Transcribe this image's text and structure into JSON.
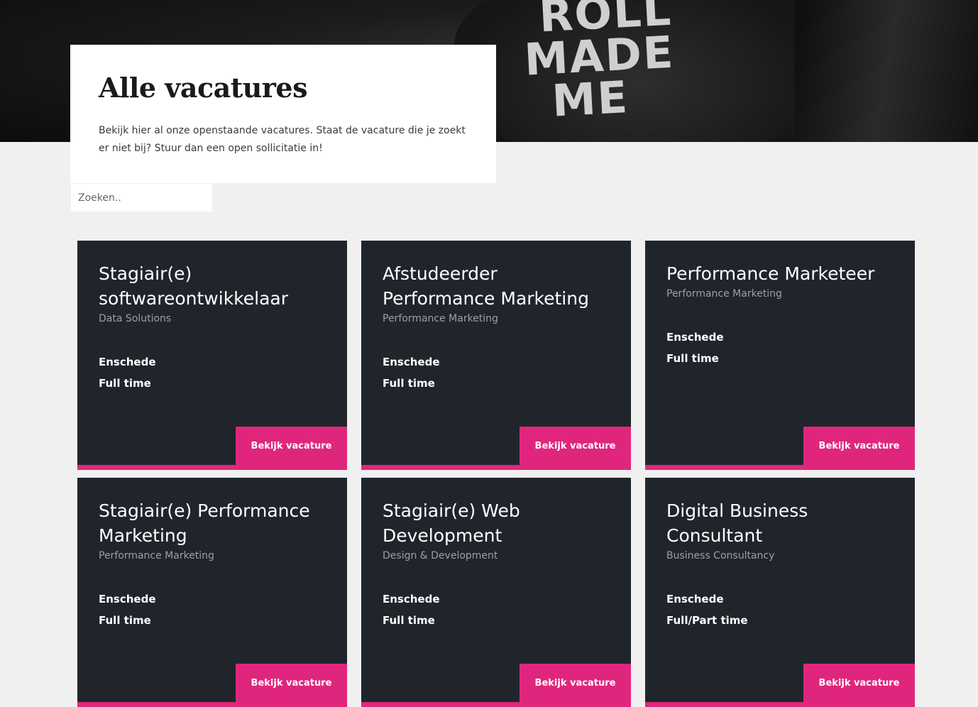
{
  "hero": {
    "shirt_lines": [
      "ROLL",
      "MADE",
      "ME"
    ]
  },
  "intro": {
    "title": "Alle vacatures",
    "description": "Bekijk hier al onze openstaande vacatures. Staat de vacature die je zoekt er niet bij? Stuur dan een open sollicitatie in!"
  },
  "search": {
    "placeholder": "Zoeken.."
  },
  "colors": {
    "card_bg": "#20252c",
    "accent": "#e0267c",
    "page_bg": "#f0f0f0"
  },
  "jobs": [
    {
      "title": "Stagiair(e) softwareontwikkelaar",
      "department": "Data Solutions",
      "location": "Enschede",
      "type": "Full time",
      "button": "Bekijk vacature"
    },
    {
      "title": "Afstudeerder Performance Marketing",
      "department": "Performance Marketing",
      "location": "Enschede",
      "type": "Full time",
      "button": "Bekijk vacature"
    },
    {
      "title": "Performance Marketeer",
      "department": "Performance Marketing",
      "location": "Enschede",
      "type": "Full time",
      "button": "Bekijk vacature"
    },
    {
      "title": "Stagiair(e) Performance Marketing",
      "department": "Performance Marketing",
      "location": "Enschede",
      "type": "Full time",
      "button": "Bekijk vacature"
    },
    {
      "title": "Stagiair(e) Web Development",
      "department": "Design & Development",
      "location": "Enschede",
      "type": "Full time",
      "button": "Bekijk vacature"
    },
    {
      "title": "Digital Business Consultant",
      "department": "Business Consultancy",
      "location": "Enschede",
      "type": "Full/Part time",
      "button": "Bekijk vacature"
    }
  ]
}
